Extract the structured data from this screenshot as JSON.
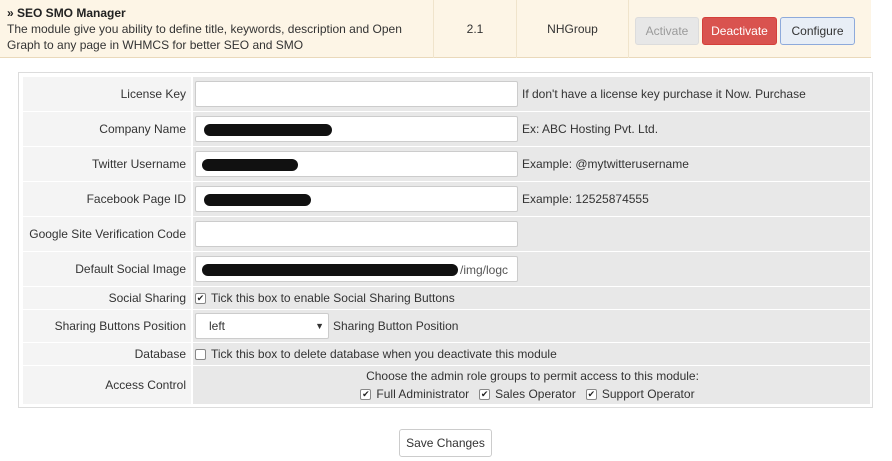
{
  "module": {
    "title": "» SEO SMO Manager",
    "description": "The module give you ability to define title, keywords, description and Open Graph to any page in WHMCS for better SEO and SMO",
    "version": "2.1",
    "vendor": "NHGroup",
    "activate_label": "Activate",
    "deactivate_label": "Deactivate",
    "configure_label": "Configure"
  },
  "config": {
    "license_key": {
      "label": "License Key",
      "value": "",
      "hint": "If don't have a license key purchase it Now. Purchase"
    },
    "company_name": {
      "label": "Company Name",
      "value": "[redacted]",
      "hint": "Ex: ABC Hosting Pvt. Ltd."
    },
    "twitter_username": {
      "label": "Twitter Username",
      "value": "[redacted]",
      "hint": "Example: @mytwitterusername"
    },
    "facebook_page_id": {
      "label": "Facebook Page ID",
      "value": "[redacted]",
      "hint": "Example: 12525874555"
    },
    "google_verification": {
      "label": "Google Site Verification Code",
      "value": ""
    },
    "default_social_image": {
      "label": "Default Social Image",
      "value_suffix": "/img/logc"
    },
    "social_sharing": {
      "label": "Social Sharing",
      "checked": true,
      "text": "Tick this box to enable Social Sharing Buttons"
    },
    "sharing_position": {
      "label": "Sharing Buttons Position",
      "selected": "left",
      "hint": "Sharing Button Position"
    },
    "database": {
      "label": "Database",
      "checked": false,
      "text": "Tick this box to delete database when you deactivate this module"
    },
    "access_control": {
      "label": "Access Control",
      "intro": "Choose the admin role groups to permit access to this module:",
      "roles": [
        {
          "name": "Full Administrator",
          "checked": true
        },
        {
          "name": "Sales Operator",
          "checked": true
        },
        {
          "name": "Support Operator",
          "checked": true
        }
      ]
    }
  },
  "save_label": "Save Changes"
}
